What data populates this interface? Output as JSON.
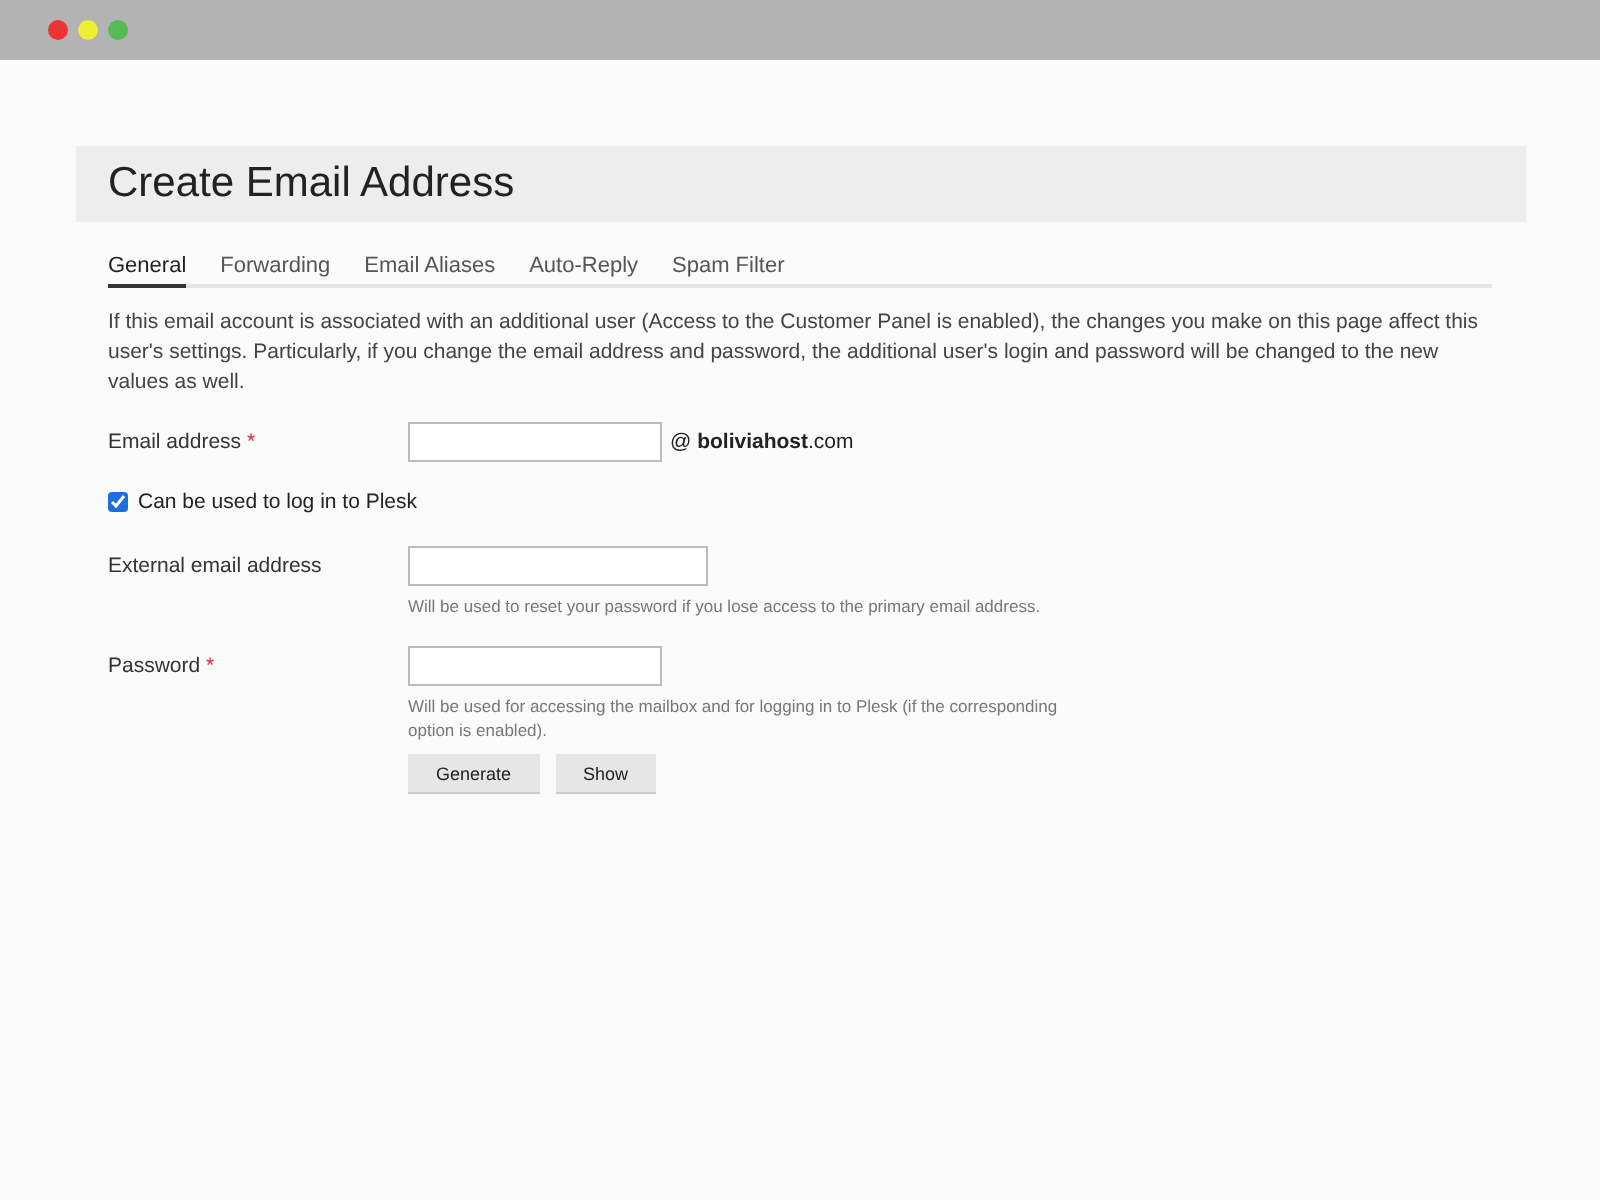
{
  "page": {
    "title": "Create Email Address"
  },
  "tabs": [
    {
      "label": "General",
      "selected": true
    },
    {
      "label": "Forwarding",
      "selected": false
    },
    {
      "label": "Email Aliases",
      "selected": false
    },
    {
      "label": "Auto-Reply",
      "selected": false
    },
    {
      "label": "Spam Filter",
      "selected": false
    }
  ],
  "notice": "If this email account is associated with an additional user (Access to the Customer Panel is enabled), the changes you make on this page affect this user's settings. Particularly, if you change the email address and password, the additional user's login and password will be changed to the new values as well.",
  "form": [
    {
      "kind": "field",
      "label": "Email address",
      "required_mark": "*",
      "suffix": "@ **boliviahost**.com"
    },
    {
      "kind": "checkbox",
      "label": "Can be used to log in to Plesk",
      "checked": true
    },
    {
      "kind": "field",
      "label": "External email address",
      "hint": "Will be used to reset your password if you lose access to the primary email address."
    },
    {
      "kind": "field",
      "label": "Password",
      "required_mark": "*",
      "hint": "Will be used for accessing the mailbox and for logging in to Plesk (if the corresponding option is enabled).",
      "buttons": [
        "Generate",
        "Show"
      ]
    }
  ]
}
